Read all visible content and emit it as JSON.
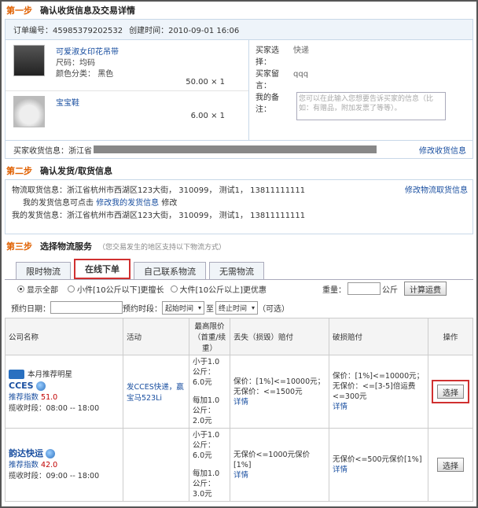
{
  "step1": {
    "num": "第一步",
    "title": "确认收货信息及交易详情"
  },
  "order": {
    "id_label": "订单编号：45985379202532",
    "created_label": "创建时间：2010-09-01 16:06"
  },
  "products": [
    {
      "name": "可爱淑女印花吊带",
      "size_label": "尺码：",
      "size": "均码",
      "color_label": "颜色分类：",
      "color": "黑色",
      "price": "50.00 × 1"
    },
    {
      "name": "宝宝鞋",
      "price": "6.00 × 1"
    }
  ],
  "buyer": {
    "choose_label": "买家选择：",
    "choose_value": "快递",
    "msg_label": "买家留言：",
    "msg_value": "qqq",
    "note_label": "我的备注：",
    "note_placeholder": "您可以在此输入您想要告诉买家的信息（比如：有赠品，附加发票了等等）。"
  },
  "receive": {
    "label": "买家收货信息：",
    "value": "浙江省",
    "edit": "修改收货信息"
  },
  "step2": {
    "num": "第二步",
    "title": "确认发货/取货信息"
  },
  "logistics": {
    "pickup": "物流取货信息：浙江省杭州市西湖区123大街， 310099， 测试1， 13811111111",
    "edit_pickup": "修改物流取货信息",
    "your_info_prefix": "我的发货信息可点击",
    "your_info_link": "修改我的发货信息",
    "your_info_suffix": "修改",
    "ship": "我的发货信息：浙江省杭州市西湖区123大街， 310099， 测试1， 13811111111"
  },
  "step3": {
    "num": "第三步",
    "title": "选择物流服务",
    "hint": "（您交易发生的地区支持以下物流方式）"
  },
  "tabs": [
    "限时物流",
    "在线下单",
    "自己联系物流",
    "无需物流"
  ],
  "filter": {
    "all": "显示全部",
    "small": "小件[10公斤以下]更擅长",
    "large": "大件[10公斤以上]更优惠",
    "weight_label": "重量：",
    "unit": "公斤",
    "calc": "计算运费"
  },
  "date": {
    "label": "预约日期：",
    "period": "预约时段：",
    "start": "起始时间",
    "to": "至",
    "end": "终止时间",
    "optional": "（可选）"
  },
  "table": {
    "headers": [
      "公司名称",
      "活动",
      "最高限价（首重/续重）",
      "丢失（损毁）赔付",
      "破损赔付",
      "操作"
    ],
    "rows": [
      {
        "badge": "本月推荐明星",
        "company": "CCES",
        "rec_label": "推荐指数",
        "rec": "51.0",
        "hours": "揽收时段：08:00 -- 18:00",
        "activity": "发CCES快递，赢宝马523Li",
        "price1": "小于1.0公斤：6.0元",
        "price2": "每加1.0公斤：2.0元",
        "loss1": "保价：[1%]<=10000元；",
        "loss2": "无保价：<=1500元",
        "loss_detail": "详情",
        "break1": "保价：[1%]<=10000元；",
        "break2": "无保价：<=[3-5]倍运费<=300元",
        "break_detail": "详情",
        "action": "选择"
      },
      {
        "company": "韵达快运",
        "rec_label": "推荐指数",
        "rec": "42.0",
        "hours": "揽收时段：09:00 -- 18:00",
        "price1": "小于1.0公斤：6.0元",
        "price2": "每加1.0公斤：3.0元",
        "loss1": "无保价<=1000元保价[1%]",
        "loss_detail": "详情",
        "break1": "无保价<=500元保价[1%]",
        "break_detail": "详情",
        "action": "选择"
      }
    ]
  }
}
